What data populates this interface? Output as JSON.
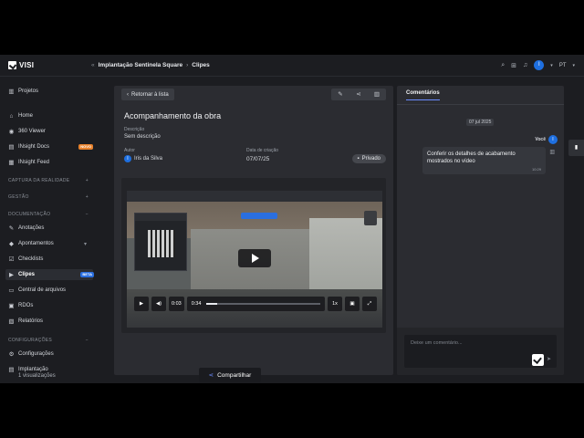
{
  "app": {
    "logo_text": "VISI"
  },
  "breadcrumb": {
    "project": "Implantação Sentinela Square",
    "section": "Clipes"
  },
  "topbar": {
    "avatar_initial": "I",
    "language": "PT"
  },
  "sidebar": {
    "projects": "Projetos",
    "items_main": [
      {
        "label": "Home",
        "icon": "home-icon"
      },
      {
        "label": "360 Viewer",
        "icon": "camera-360-icon"
      },
      {
        "label": "INsight Docs",
        "icon": "docs-icon",
        "badge": "NOVO"
      },
      {
        "label": "INsight Feed",
        "icon": "feed-icon"
      }
    ],
    "sections": {
      "capture": "CAPTURA DA REALIDADE",
      "management": "GESTÃO",
      "documentation": "DOCUMENTAÇÃO",
      "settings": "CONFIGURAÇÕES"
    },
    "items_docs": [
      {
        "label": "Anotações",
        "icon": "annotation-icon"
      },
      {
        "label": "Apontamentos",
        "icon": "pin-icon"
      },
      {
        "label": "Checklists",
        "icon": "checklist-icon"
      },
      {
        "label": "Clipes",
        "icon": "clip-icon",
        "badge": "BETA",
        "active": true
      },
      {
        "label": "Central de arquivos",
        "icon": "folder-icon"
      },
      {
        "label": "RDOs",
        "icon": "report-icon"
      },
      {
        "label": "Relatórios",
        "icon": "chart-icon"
      }
    ],
    "items_settings": [
      {
        "label": "Configurações",
        "icon": "gear-icon"
      },
      {
        "label": "Implantação",
        "icon": "deploy-icon"
      }
    ]
  },
  "clip": {
    "back_label": "Retornar à lista",
    "title": "Acompanhamento da obra",
    "description_label": "Descrição",
    "description_value": "Sem descrição",
    "author_label": "Autor",
    "author_name": "Iris da Silva",
    "author_initial": "I",
    "date_label": "Data de criação",
    "date_value": "07/07/25",
    "privacy": "Privado",
    "views": "1 visualizações",
    "share_label": "Compartilhar",
    "player": {
      "elapsed": "0:03",
      "duration": "0:34",
      "speed": "1x",
      "progress": 0.09
    }
  },
  "comments": {
    "tab_label": "Comentários",
    "date_chip": "07 jul 2025",
    "author": "Você",
    "author_initial": "I",
    "message": "Conferir os detalhes de acabamento mostrados no vídeo",
    "time": "10:29",
    "input_placeholder": "Deixe um comentário..."
  },
  "colors": {
    "accent": "#1e6fe0",
    "badge_new": "#e8822c",
    "badge_beta": "#2a6fe0",
    "background": "#1c1d21",
    "panel": "#2b2c31"
  }
}
